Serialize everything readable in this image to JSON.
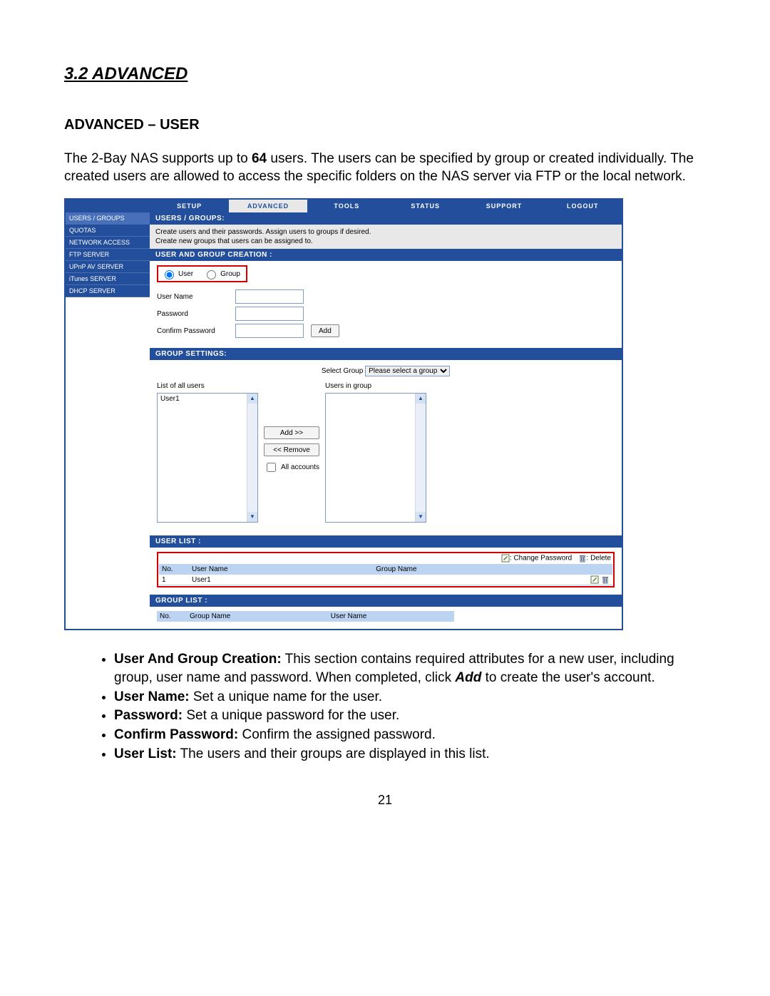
{
  "doc": {
    "section_title": "3.2 ADVANCED",
    "subsection_title": "ADVANCED – USER",
    "intro_pre": "The 2-Bay NAS supports up to ",
    "intro_bold": "64",
    "intro_post": " users. The users can be specified by group or created individually. The created users are allowed to access the specific folders on the NAS server via FTP or the local network.",
    "page_number": "21"
  },
  "topnav": {
    "tabs": [
      "SETUP",
      "ADVANCED",
      "TOOLS",
      "STATUS",
      "SUPPORT",
      "LOGOUT"
    ],
    "active_index": 1
  },
  "sidebar": {
    "items": [
      "USERS / GROUPS",
      "QUOTAS",
      "NETWORK ACCESS",
      "FTP SERVER",
      "UPnP AV SERVER",
      "iTunes SERVER",
      "DHCP SERVER"
    ],
    "active_index": 0
  },
  "panel_users_groups": {
    "heading": "USERS / GROUPS:",
    "desc_line1": "Create users and their passwords. Assign users to groups if desired.",
    "desc_line2": "Create new groups that users can be assigned to."
  },
  "panel_creation": {
    "heading": "USER AND GROUP CREATION :",
    "radio_user": "User",
    "radio_group": "Group",
    "label_username": "User Name",
    "label_password": "Password",
    "label_confirm": "Confirm Password",
    "btn_add": "Add"
  },
  "panel_group_settings": {
    "heading": "GROUP SETTINGS:",
    "select_label": "Select Group",
    "select_placeholder": "Please select a group",
    "list_all_label": "List of all users",
    "users_in_group_label": "Users in group",
    "all_users": [
      "User1"
    ],
    "btn_add": "Add >>",
    "btn_remove": "<< Remove",
    "chk_all": "All accounts"
  },
  "panel_user_list": {
    "heading": "USER LIST :",
    "legend_change": ": Change Password",
    "legend_delete": ": Delete",
    "cols": {
      "no": "No.",
      "user": "User Name",
      "group": "Group Name"
    },
    "rows": [
      {
        "no": "1",
        "user": "User1",
        "group": ""
      }
    ]
  },
  "panel_group_list": {
    "heading": "GROUP LIST :",
    "cols": {
      "no": "No.",
      "group": "Group Name",
      "user": "User Name"
    }
  },
  "bullets": {
    "b1_t": "User And Group Creation:",
    "b1_r": " This section contains required attributes for a new user, including group, user name and password. When completed, click ",
    "b1_add": "Add",
    "b1_r2": " to create the user's account.",
    "b2_t": "User Name:",
    "b2_r": " Set a unique name for the user.",
    "b3_t": "Password:",
    "b3_r": " Set a unique password for the user.",
    "b4_t": "Confirm Password:",
    "b4_r": " Confirm the assigned password.",
    "b5_t": "User List:",
    "b5_r": " The users and their groups are displayed in this list."
  }
}
